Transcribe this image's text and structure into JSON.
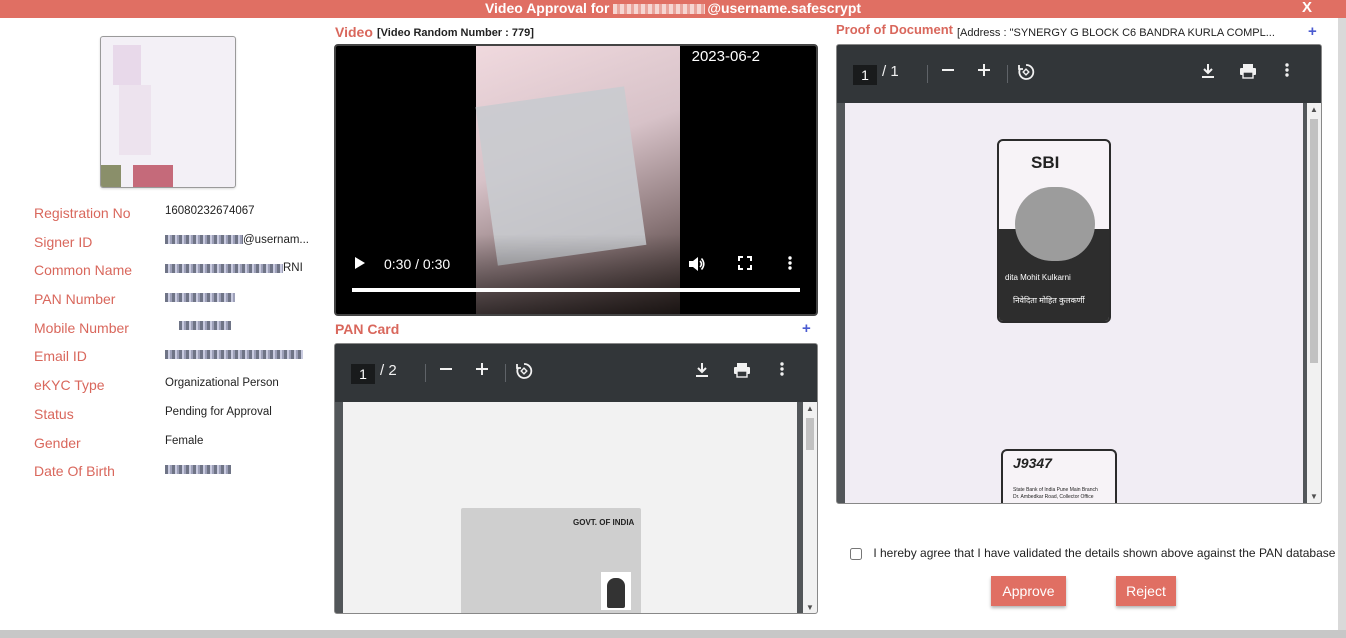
{
  "dialog": {
    "title_prefix": "Video Approval for",
    "title_suffix": "@username.safescrypt",
    "close_label": "X"
  },
  "details": [
    {
      "label": "Registration No",
      "value": "16080232674067"
    },
    {
      "label": "Signer ID",
      "value": "@usernam..."
    },
    {
      "label": "Common Name",
      "value": "RNI"
    },
    {
      "label": "PAN Number",
      "value": ""
    },
    {
      "label": "Mobile Number",
      "value": ""
    },
    {
      "label": "Email ID",
      "value": ""
    },
    {
      "label": "eKYC Type",
      "value": "Organizational Person"
    },
    {
      "label": "Status",
      "value": "Pending for Approval"
    },
    {
      "label": "Gender",
      "value": "Female"
    },
    {
      "label": "Date Of Birth",
      "value": ""
    }
  ],
  "video": {
    "title": "Video",
    "subtitle": "[Video Random Number : 779]",
    "timestamp": "2023-06-2",
    "time": "0:30 / 0:30",
    "progress": 1.0
  },
  "pan_card": {
    "title": "PAN Card",
    "add_label": "+",
    "page_current": "1",
    "page_total": "/  2",
    "card_text": "GOVT. OF INDIA"
  },
  "proof": {
    "title": "Proof of Document",
    "address": "[Address : \"SYNERGY G BLOCK C6 BANDRA KURLA COMPL...",
    "add_label": "+",
    "page_current": "1",
    "page_total": "/  1",
    "card_brand": "SBI",
    "card_name": "dita Mohit Kulkarni",
    "card_hindi": "निवेदिता मोहित कुलकर्णी",
    "card2_number": "J9347",
    "card2_line1": "State Bank of India Pune Main Branch",
    "card2_line2": "Dr. Ambedkar Road, Collector Office"
  },
  "consent": {
    "text": "I hereby agree that I have validated the details shown above against the PAN database"
  },
  "actions": {
    "approve": "Approve",
    "reject": "Reject"
  },
  "icons": [
    "play-icon",
    "volume-icon",
    "fullscreen-icon",
    "more-vert-icon",
    "zoom-out-icon",
    "zoom-in-icon",
    "rotate-icon",
    "download-icon",
    "print-icon",
    "close-icon",
    "plus-icon"
  ]
}
